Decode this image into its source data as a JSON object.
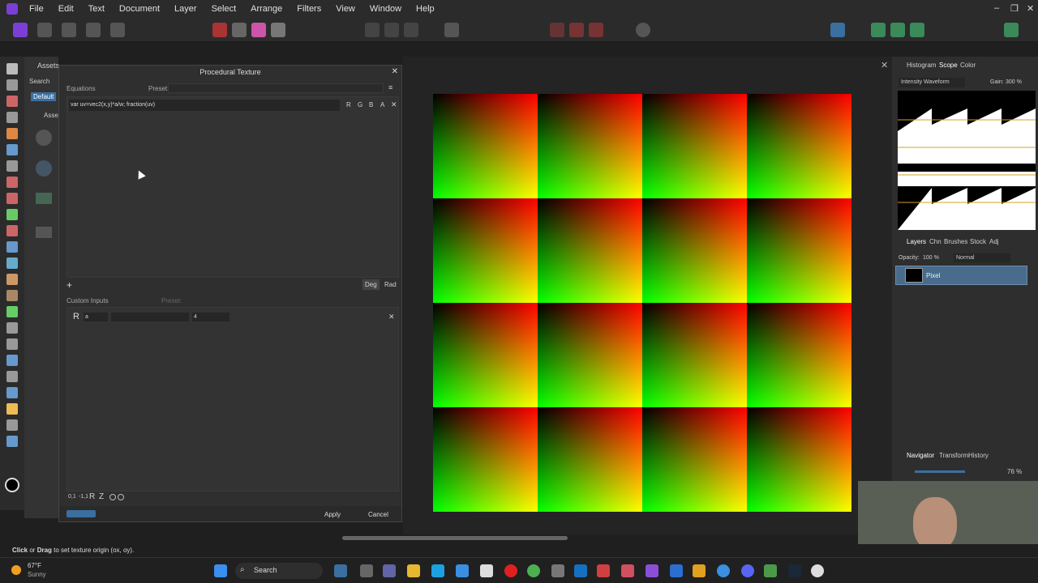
{
  "menu": [
    "File",
    "Edit",
    "Text",
    "Document",
    "Layer",
    "Select",
    "Arrange",
    "Filters",
    "View",
    "Window",
    "Help"
  ],
  "assets": {
    "title": "Assets",
    "search": "Search",
    "tab": "Default",
    "section": "Asse"
  },
  "dialog": {
    "title": "Procedural Texture",
    "equations_label": "Equations",
    "preset_label": "Preset:",
    "equation": "var uv=vec2(x,y)*a/w; fraction(uv)",
    "channels": [
      "R",
      "G",
      "B",
      "A"
    ],
    "deg": "Deg",
    "rad": "Rad",
    "custom_inputs_label": "Custom Inputs",
    "custom_preset_label": "Preset:",
    "input_type": "R",
    "input_name": "a",
    "input_value": "4",
    "bottom_icons": [
      "0,1",
      "-1,1",
      "R",
      "Z"
    ],
    "apply": "Apply",
    "cancel": "Cancel"
  },
  "right": {
    "tabs1": [
      "Histogram",
      "Scope",
      "Color"
    ],
    "scope_mode": "Intensity Waveform",
    "gain_label": "Gain:",
    "gain": "300 %",
    "tabs2": [
      "Layers",
      "Chn",
      "Brushes",
      "Stock",
      "Adj"
    ],
    "opacity_label": "Opacity:",
    "opacity": "100 %",
    "blend": "Normal",
    "layer_name": "Pixel",
    "tabs3": [
      "Navigator",
      "Transform",
      "History"
    ],
    "zoom": "76 %"
  },
  "status": {
    "click": "Click",
    "or": " or ",
    "drag": "Drag",
    "rest": " to set texture origin (ox, oy)."
  },
  "taskbar": {
    "temp": "67°F",
    "weather": "Sunny",
    "search": "Search"
  }
}
